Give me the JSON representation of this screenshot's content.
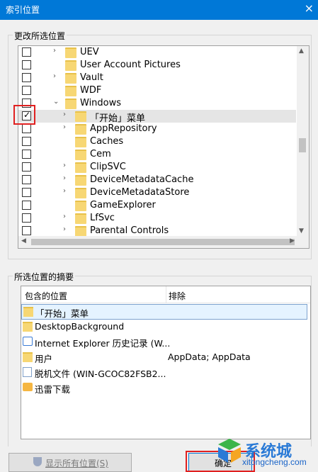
{
  "window": {
    "title": "索引位置",
    "close_glyph": "×"
  },
  "change_section": {
    "label": "更改所选位置"
  },
  "tree": {
    "items": [
      {
        "label": "UEV",
        "checked": false,
        "expander": "›",
        "indent": 1
      },
      {
        "label": "User Account Pictures",
        "checked": false,
        "expander": "",
        "indent": 1
      },
      {
        "label": "Vault",
        "checked": false,
        "expander": "›",
        "indent": 1
      },
      {
        "label": "WDF",
        "checked": false,
        "expander": "",
        "indent": 1
      },
      {
        "label": "Windows",
        "checked": false,
        "expander": "⌄",
        "indent": 1
      },
      {
        "label": "「开始」菜单",
        "checked": true,
        "expander": "›",
        "indent": 2,
        "selected": true
      },
      {
        "label": "AppRepository",
        "checked": false,
        "expander": "›",
        "indent": 2
      },
      {
        "label": "Caches",
        "checked": false,
        "expander": "",
        "indent": 2
      },
      {
        "label": "Cem",
        "checked": false,
        "expander": "",
        "indent": 2
      },
      {
        "label": "ClipSVC",
        "checked": false,
        "expander": "›",
        "indent": 2
      },
      {
        "label": "DeviceMetadataCache",
        "checked": false,
        "expander": "›",
        "indent": 2
      },
      {
        "label": "DeviceMetadataStore",
        "checked": false,
        "expander": "›",
        "indent": 2
      },
      {
        "label": "GameExplorer",
        "checked": false,
        "expander": "",
        "indent": 2
      },
      {
        "label": "LfSvc",
        "checked": false,
        "expander": "›",
        "indent": 2
      },
      {
        "label": "Parental Controls",
        "checked": false,
        "expander": "›",
        "indent": 2
      }
    ],
    "check_glyph": "✓",
    "scroll_up": "▲",
    "scroll_down": "▼",
    "scroll_left": "◀",
    "scroll_right": "▶"
  },
  "summary_section": {
    "label": "所选位置的摘要"
  },
  "summary": {
    "col_included": "包含的位置",
    "col_excluded": "排除",
    "rows": [
      {
        "location": "「开始」菜单",
        "exclude": "",
        "icon": "folder-icon",
        "selected": true
      },
      {
        "location": "DesktopBackground",
        "exclude": "",
        "icon": "folder-icon"
      },
      {
        "location": "Internet Explorer 历史记录 (W...",
        "exclude": "",
        "icon": "ie-icon"
      },
      {
        "location": "用户",
        "exclude": "AppData; AppData",
        "icon": "folder-icon"
      },
      {
        "location": "脱机文件 (WIN-GCOC82FSB2...",
        "exclude": "",
        "icon": "offline-files-icon"
      },
      {
        "location": "迅雷下载",
        "exclude": "",
        "icon": "xunlei-folder-icon"
      }
    ]
  },
  "buttons": {
    "show_all": "显示所有位置(S)",
    "ok": "确定"
  },
  "watermark": {
    "brand": "系统城",
    "site": "xitongcheng.com"
  },
  "colors": {
    "accent": "#0078d7",
    "highlight_box": "#e02020"
  }
}
